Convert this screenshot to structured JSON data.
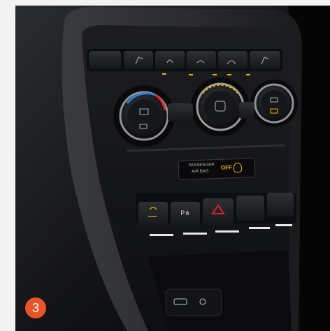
{
  "figure_number": "3",
  "panel": {
    "airbag_label_line1": "PASSENGER",
    "airbag_label_line2": "AIR BAG",
    "airbag_status": "OFF",
    "airbag_icon": "airbag-off-icon",
    "climate_buttons": [
      "seat-heat-left-icon",
      "fan-icon",
      "ac-icon",
      "recirculation-icon",
      "defrost-rear-icon",
      "seat-heat-right-icon"
    ],
    "lower_buttons": [
      "esc-off-icon",
      "parking-sensor-icon",
      "hazard-icon",
      "blank-button",
      "blank-button"
    ],
    "knobs": [
      "temperature-left-knob",
      "fan-speed-knob",
      "temperature-right-knob"
    ],
    "colors": {
      "badge": "#e8552a",
      "indicator_led": "#f0b400",
      "hazard": "#d8232a"
    }
  }
}
